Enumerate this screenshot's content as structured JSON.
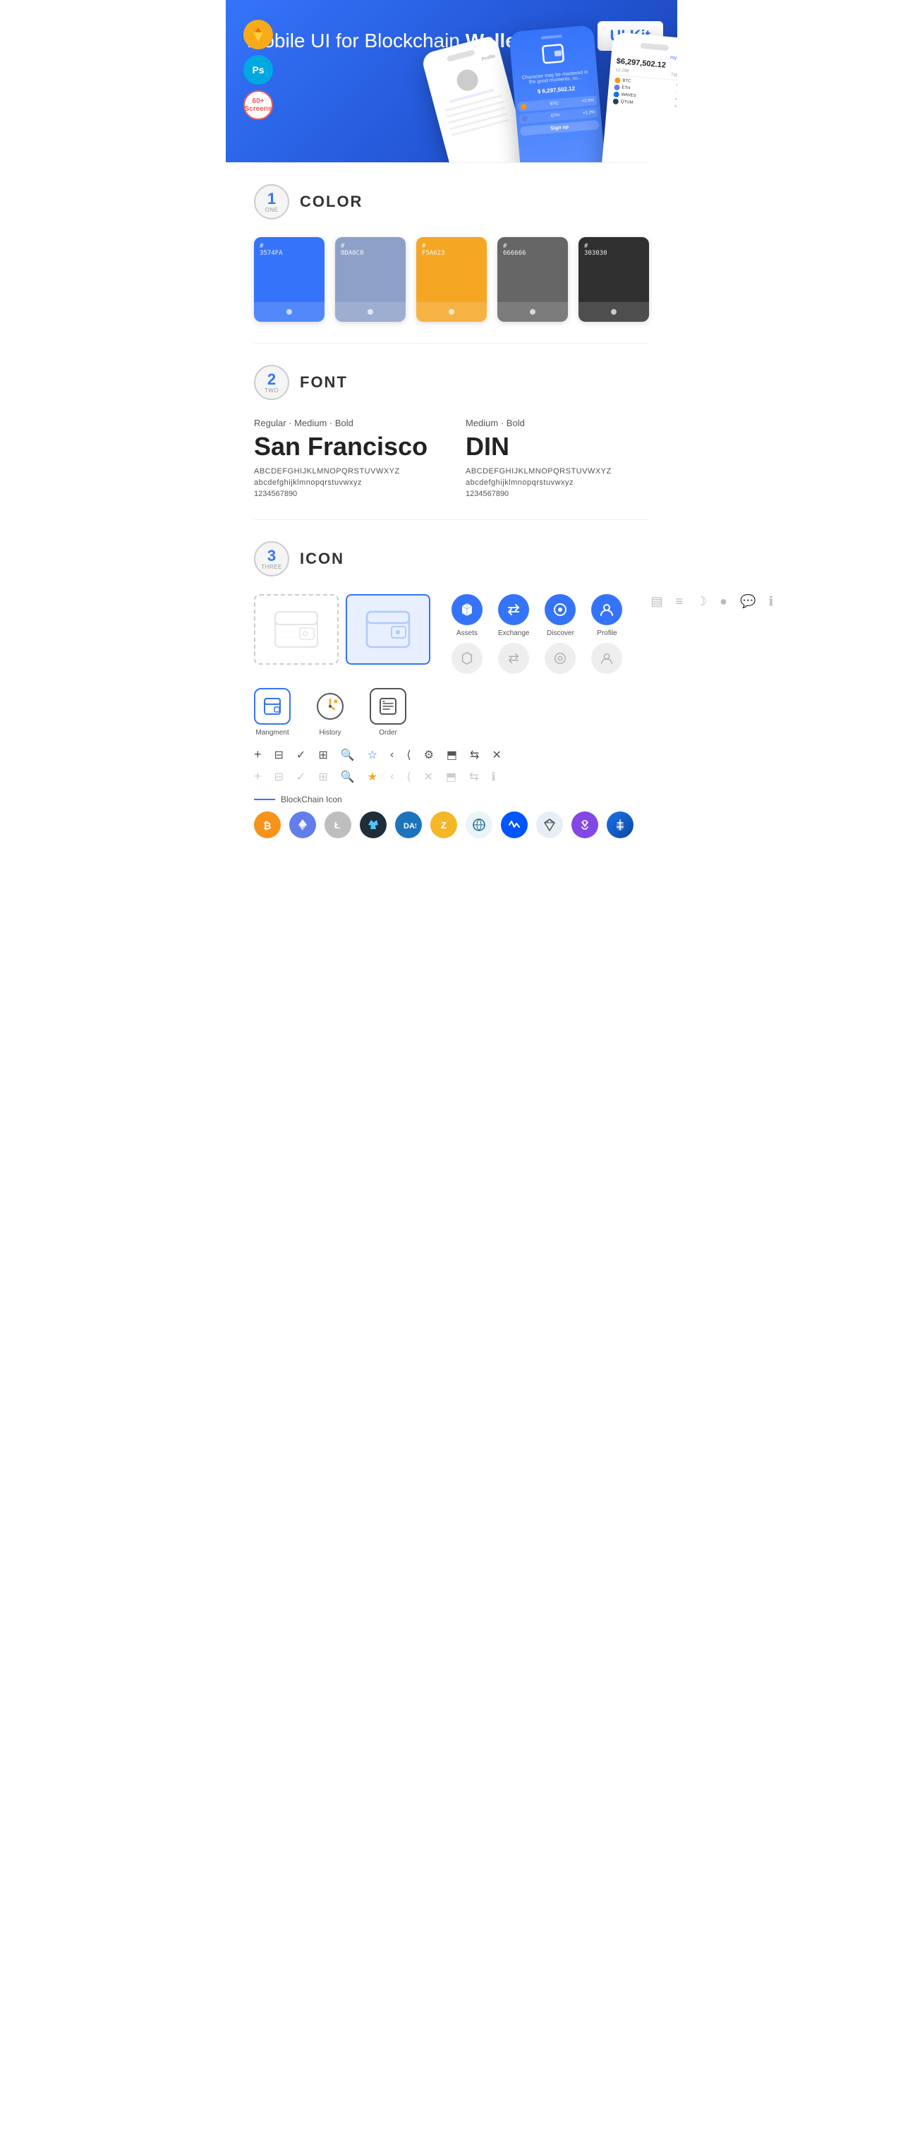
{
  "hero": {
    "title_normal": "Mobile UI for Blockchain ",
    "title_bold": "Wallet",
    "badge": "UI Kit",
    "badges": [
      {
        "label": "S",
        "type": "sketch"
      },
      {
        "label": "Ps",
        "type": "ps"
      },
      {
        "label": "60+\nScreens",
        "type": "screens"
      }
    ]
  },
  "sections": {
    "color": {
      "number": "1",
      "word": "ONE",
      "title": "COLOR",
      "swatches": [
        {
          "hex": "#3574FA",
          "code": "#\n3574FA"
        },
        {
          "hex": "#8DA0C8",
          "code": "#\n8DA0C8"
        },
        {
          "hex": "#F5A623",
          "code": "#\nF5A623"
        },
        {
          "hex": "#666666",
          "code": "#\n666666"
        },
        {
          "hex": "#303030",
          "code": "#\n303030"
        }
      ]
    },
    "font": {
      "number": "2",
      "word": "TWO",
      "title": "FONT",
      "fonts": [
        {
          "styles": "Regular · Medium · Bold",
          "name": "San Francisco",
          "upper": "ABCDEFGHIJKLMNOPQRSTUVWXYZ",
          "lower": "abcdefghijklmnopqrstuvwxyz",
          "nums": "1234567890"
        },
        {
          "styles": "Medium · Bold",
          "name": "DIN",
          "upper": "ABCDEFGHIJKLMNOPQRSTUVWXYZ",
          "lower": "abcdefghijklmnopqrstuvwxyz",
          "nums": "1234567890"
        }
      ]
    },
    "icon": {
      "number": "3",
      "word": "THREE",
      "title": "ICON",
      "nav_icons": [
        {
          "label": "Assets",
          "color": "#3574FA",
          "symbol": "◆"
        },
        {
          "label": "Exchange",
          "color": "#3574FA",
          "symbol": "⇄"
        },
        {
          "label": "Discover",
          "color": "#3574FA",
          "symbol": "◉"
        },
        {
          "label": "Profile",
          "color": "#3574FA",
          "symbol": "👤"
        }
      ],
      "bottom_icons": [
        {
          "label": "Mangment",
          "type": "mgmt"
        },
        {
          "label": "History",
          "type": "history"
        },
        {
          "label": "Order",
          "type": "order"
        }
      ],
      "small_icons": [
        "+",
        "☰",
        "✓",
        "⊞",
        "🔍",
        "☆",
        "‹",
        "⟨",
        "⚙",
        "⬒",
        "⇆",
        "✕"
      ],
      "blockchain_label": "BlockChain Icon",
      "crypto_colors": [
        "#F7931A",
        "#627EEA",
        "#B5B5B5",
        "#1F2C39",
        "#1EC0A0",
        "#9B59B6",
        "#345D9D",
        "#444",
        "#FF0090",
        "#8247E5"
      ]
    }
  }
}
